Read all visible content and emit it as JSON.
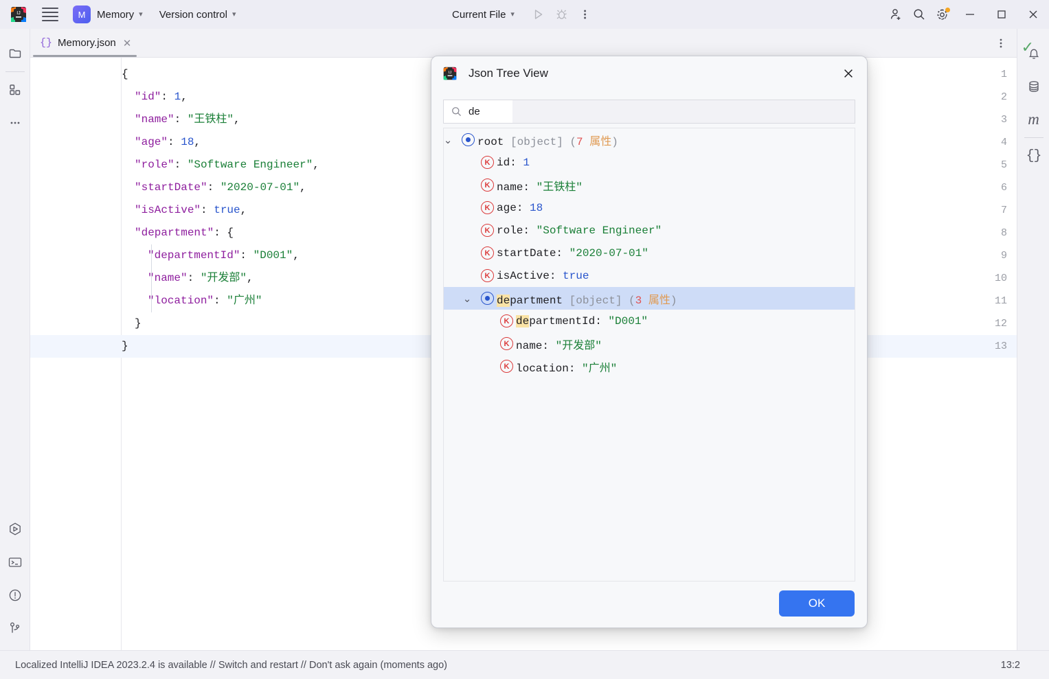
{
  "toolbar": {
    "app_logo": "intellij-logo",
    "menu_icon": "hamburger-menu-icon",
    "project_badge": "M",
    "project_name": "Memory",
    "version_control": "Version control",
    "run_config": "Current File",
    "run_icon": "run-icon",
    "debug_icon": "debug-icon",
    "more_icon": "more-vertical-icon",
    "share_icon": "add-user-icon",
    "search_icon": "search-icon",
    "settings_icon": "gear-icon",
    "minimize": "—",
    "maximize": "□",
    "close": "✕"
  },
  "left_stripe": {
    "top_items": [
      {
        "name": "project-tool-window",
        "icon": "folder-icon"
      },
      {
        "name": "structure-tool-window",
        "icon": "structure-blocks-icon"
      },
      {
        "name": "more-tool-windows",
        "icon": "ellipsis-icon"
      }
    ],
    "bottom_items": [
      {
        "name": "run-tool-window",
        "icon": "run-hexagon-icon"
      },
      {
        "name": "terminal-tool-window",
        "icon": "terminal-icon"
      },
      {
        "name": "problems-tool-window",
        "icon": "warning-circle-icon"
      },
      {
        "name": "git-tool-window",
        "icon": "git-branch-icon"
      }
    ]
  },
  "right_stripe": {
    "items": [
      {
        "name": "notifications",
        "icon": "bell-icon"
      },
      {
        "name": "database",
        "icon": "database-icon"
      },
      {
        "name": "maven",
        "icon": "maven-m-icon",
        "glyph": "m"
      },
      {
        "name": "json-tree",
        "icon": "curly-braces-icon",
        "glyph": "{}"
      }
    ]
  },
  "editor": {
    "tab": {
      "icon": "json-file-icon",
      "label": "Memory.json",
      "close": "✕"
    },
    "tabbar_more": "more-vertical-icon",
    "inspection_status": "✓",
    "caret_line": 13,
    "lines": [
      {
        "no": 1,
        "indent": 0,
        "tokens": [
          {
            "t": "{",
            "c": "br"
          }
        ]
      },
      {
        "no": 2,
        "indent": 1,
        "tokens": [
          {
            "t": "\"id\"",
            "c": "k"
          },
          {
            "t": ": ",
            "c": "p"
          },
          {
            "t": "1",
            "c": "n"
          },
          {
            "t": ",",
            "c": "p"
          }
        ]
      },
      {
        "no": 3,
        "indent": 1,
        "tokens": [
          {
            "t": "\"name\"",
            "c": "k"
          },
          {
            "t": ": ",
            "c": "p"
          },
          {
            "t": "\"王铁柱\"",
            "c": "s"
          },
          {
            "t": ",",
            "c": "p"
          }
        ]
      },
      {
        "no": 4,
        "indent": 1,
        "tokens": [
          {
            "t": "\"age\"",
            "c": "k"
          },
          {
            "t": ": ",
            "c": "p"
          },
          {
            "t": "18",
            "c": "n"
          },
          {
            "t": ",",
            "c": "p"
          }
        ]
      },
      {
        "no": 5,
        "indent": 1,
        "tokens": [
          {
            "t": "\"role\"",
            "c": "k"
          },
          {
            "t": ": ",
            "c": "p"
          },
          {
            "t": "\"Software Engineer\"",
            "c": "s"
          },
          {
            "t": ",",
            "c": "p"
          }
        ]
      },
      {
        "no": 6,
        "indent": 1,
        "tokens": [
          {
            "t": "\"startDate\"",
            "c": "k"
          },
          {
            "t": ": ",
            "c": "p"
          },
          {
            "t": "\"2020-07-01\"",
            "c": "s"
          },
          {
            "t": ",",
            "c": "p"
          }
        ]
      },
      {
        "no": 7,
        "indent": 1,
        "tokens": [
          {
            "t": "\"isActive\"",
            "c": "k"
          },
          {
            "t": ": ",
            "c": "p"
          },
          {
            "t": "true",
            "c": "b"
          },
          {
            "t": ",",
            "c": "p"
          }
        ]
      },
      {
        "no": 8,
        "indent": 1,
        "tokens": [
          {
            "t": "\"department\"",
            "c": "k"
          },
          {
            "t": ": ",
            "c": "p"
          },
          {
            "t": "{",
            "c": "br"
          }
        ]
      },
      {
        "no": 9,
        "indent": 2,
        "tokens": [
          {
            "t": "\"departmentId\"",
            "c": "k"
          },
          {
            "t": ": ",
            "c": "p"
          },
          {
            "t": "\"D001\"",
            "c": "s"
          },
          {
            "t": ",",
            "c": "p"
          }
        ]
      },
      {
        "no": 10,
        "indent": 2,
        "tokens": [
          {
            "t": "\"name\"",
            "c": "k"
          },
          {
            "t": ": ",
            "c": "p"
          },
          {
            "t": "\"开发部\"",
            "c": "s"
          },
          {
            "t": ",",
            "c": "p"
          }
        ]
      },
      {
        "no": 11,
        "indent": 2,
        "tokens": [
          {
            "t": "\"location\"",
            "c": "k"
          },
          {
            "t": ": ",
            "c": "p"
          },
          {
            "t": "\"广州\"",
            "c": "s"
          }
        ]
      },
      {
        "no": 12,
        "indent": 1,
        "tokens": [
          {
            "t": "}",
            "c": "br"
          }
        ]
      },
      {
        "no": 13,
        "indent": 0,
        "tokens": [
          {
            "t": "}",
            "c": "br"
          }
        ]
      }
    ]
  },
  "dialog": {
    "logo": "intellij-logo",
    "title": "Json Tree View",
    "close_icon": "close-icon",
    "search": {
      "icon": "search-icon",
      "value": "de",
      "placeholder": ""
    },
    "ok_label": "OK",
    "tree": [
      {
        "indent": 0,
        "expandable": true,
        "expanded": true,
        "icon": "object-node-icon",
        "selected": false,
        "name": "root",
        "name_hl": "",
        "type": "[object]",
        "count": "7",
        "count_unit": "属性",
        "value": "",
        "value_kind": ""
      },
      {
        "indent": 1,
        "expandable": false,
        "icon": "key-node-icon",
        "selected": false,
        "name": "id",
        "name_hl": "",
        "type": "",
        "count": "",
        "count_unit": "",
        "value": "1",
        "value_kind": "num"
      },
      {
        "indent": 1,
        "expandable": false,
        "icon": "key-node-icon",
        "selected": false,
        "name": "name",
        "name_hl": "",
        "type": "",
        "count": "",
        "count_unit": "",
        "value": "\"王铁柱\"",
        "value_kind": "str"
      },
      {
        "indent": 1,
        "expandable": false,
        "icon": "key-node-icon",
        "selected": false,
        "name": "age",
        "name_hl": "",
        "type": "",
        "count": "",
        "count_unit": "",
        "value": "18",
        "value_kind": "num"
      },
      {
        "indent": 1,
        "expandable": false,
        "icon": "key-node-icon",
        "selected": false,
        "name": "role",
        "name_hl": "",
        "type": "",
        "count": "",
        "count_unit": "",
        "value": "\"Software Engineer\"",
        "value_kind": "str"
      },
      {
        "indent": 1,
        "expandable": false,
        "icon": "key-node-icon",
        "selected": false,
        "name": "startDate",
        "name_hl": "",
        "type": "",
        "count": "",
        "count_unit": "",
        "value": "\"2020-07-01\"",
        "value_kind": "str"
      },
      {
        "indent": 1,
        "expandable": false,
        "icon": "key-node-icon",
        "selected": false,
        "name": "isActive",
        "name_hl": "",
        "type": "",
        "count": "",
        "count_unit": "",
        "value": "true",
        "value_kind": "bool"
      },
      {
        "indent": 1,
        "expandable": true,
        "expanded": true,
        "icon": "object-node-icon",
        "selected": true,
        "name": "department",
        "name_hl": "de",
        "type": "[object]",
        "count": "3",
        "count_unit": "属性",
        "value": "",
        "value_kind": ""
      },
      {
        "indent": 2,
        "expandable": false,
        "icon": "key-node-icon",
        "selected": false,
        "name": "departmentId",
        "name_hl": "de",
        "type": "",
        "count": "",
        "count_unit": "",
        "value": "\"D001\"",
        "value_kind": "str"
      },
      {
        "indent": 2,
        "expandable": false,
        "icon": "key-node-icon",
        "selected": false,
        "name": "name",
        "name_hl": "",
        "type": "",
        "count": "",
        "count_unit": "",
        "value": "\"开发部\"",
        "value_kind": "str"
      },
      {
        "indent": 2,
        "expandable": false,
        "icon": "key-node-icon",
        "selected": false,
        "name": "location",
        "name_hl": "",
        "type": "",
        "count": "",
        "count_unit": "",
        "value": "\"广州\"",
        "value_kind": "str"
      }
    ]
  },
  "statusbar": {
    "message": "Localized IntelliJ IDEA 2023.2.4 is available // Switch and restart // Don't ask again (moments ago)",
    "caret_position": "13:2"
  },
  "colors": {
    "accent_blue": "#3574F0",
    "selection_blue": "#CEDCF7",
    "highlight_yellow": "#FAE3A6",
    "string_green": "#1A7F37",
    "key_purple": "#8E1E9E",
    "number_blue": "#2955CC",
    "key_icon_red": "#DB3B3B",
    "check_green": "#59A869",
    "gear_dot_orange": "#F5A623"
  }
}
